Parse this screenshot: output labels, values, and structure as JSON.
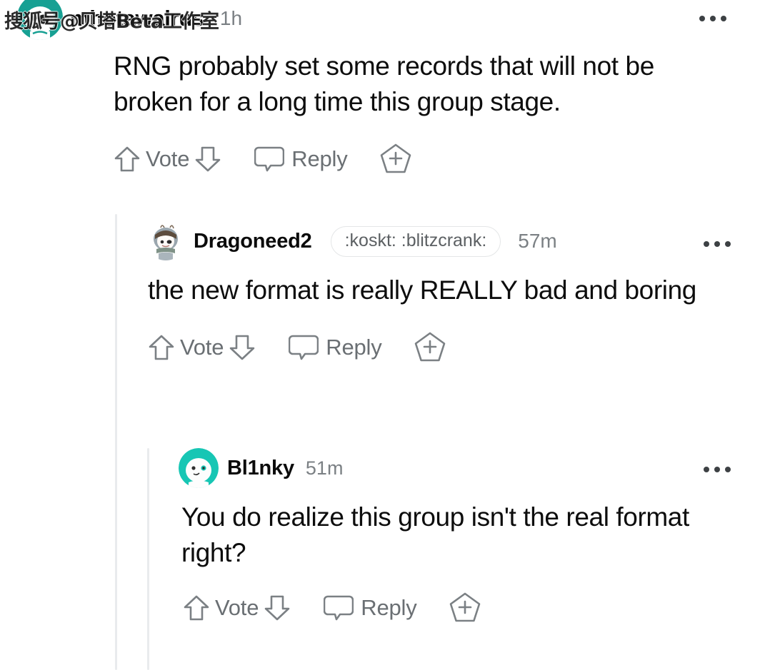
{
  "watermark": {
    "text": "搜狐号@贝塔Beta工作室"
  },
  "actions": {
    "vote_label": "Vote",
    "reply_label": "Reply",
    "upvote_icon": "upvote-arrow-icon",
    "downvote_icon": "downvote-arrow-icon",
    "reply_icon": "speech-bubble-icon",
    "award_icon": "award-plus-pentagon-icon",
    "overflow_icon": "overflow-dots-icon"
  },
  "colors": {
    "text": "#0d0d0d",
    "muted": "#6a6f73",
    "timestamp": "#7b8084",
    "thread_line": "#e9ebed",
    "avatar_teal": "#17b0a0",
    "avatar_slate": "#9aa6ae",
    "background": "#ffffff"
  },
  "comments": [
    {
      "id": "comment-1",
      "username": "mhotawalrus",
      "timestamp": "1h",
      "flair": null,
      "avatar": "snoo-avatar-teal",
      "body": "RNG probably set some records that will not be broken for a long time this group stage.",
      "depth": 0
    },
    {
      "id": "comment-2",
      "username": "Dragoneed2",
      "timestamp": "57m",
      "flair": ":koskt: :blitzcrank:",
      "avatar": "snoo-avatar-slate",
      "body": "the new format is really REALLY bad and boring",
      "depth": 1
    },
    {
      "id": "comment-3",
      "username": "Bl1nky",
      "timestamp": "51m",
      "flair": null,
      "avatar": "snoo-avatar-teal",
      "body": "You do realize this group isn't the real format right?",
      "depth": 2
    }
  ]
}
